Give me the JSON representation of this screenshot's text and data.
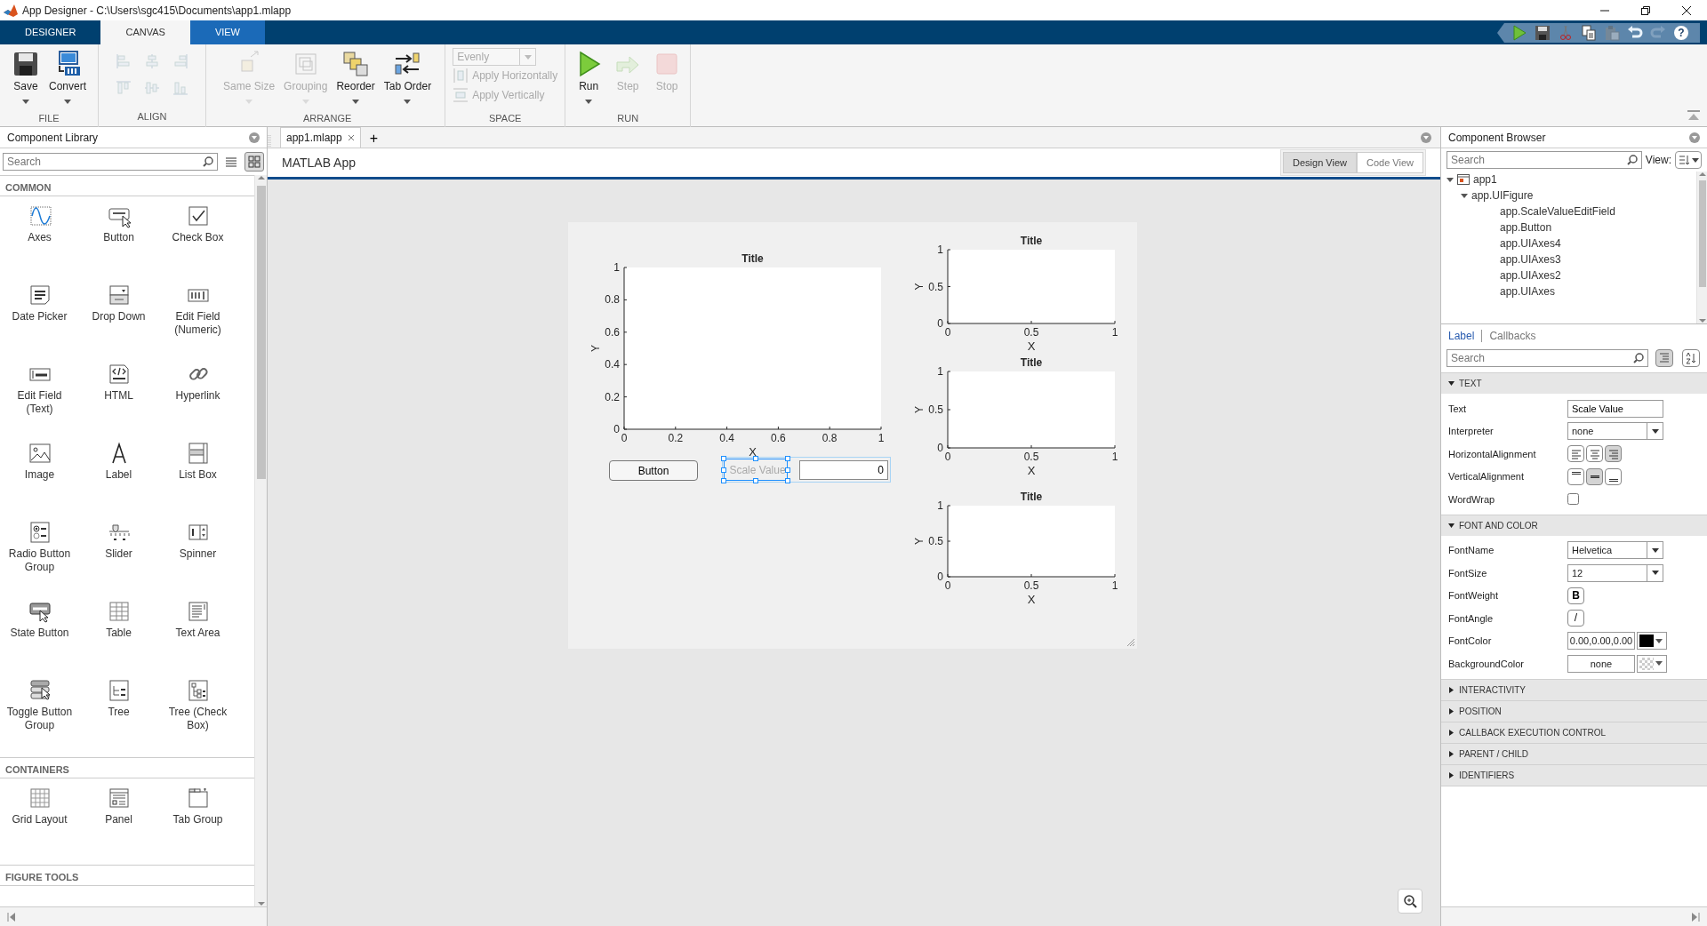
{
  "window": {
    "title": "App Designer - C:\\Users\\sgc415\\Documents\\app1.mlapp"
  },
  "ribbon_tabs": [
    {
      "label": "DESIGNER",
      "kind": "standard",
      "selected": false
    },
    {
      "label": "CANVAS",
      "kind": "standard",
      "selected": true
    },
    {
      "label": "VIEW",
      "kind": "contextual",
      "selected": false
    }
  ],
  "quick_access": [
    {
      "kind": "run",
      "disabled": false
    },
    {
      "kind": "save",
      "disabled": false
    },
    {
      "kind": "cut",
      "disabled": false
    },
    {
      "kind": "copy",
      "disabled": false
    },
    {
      "kind": "paste",
      "disabled": true
    },
    {
      "kind": "undo",
      "disabled": false
    },
    {
      "kind": "redo",
      "disabled": true
    },
    {
      "kind": "help",
      "glyph": "?",
      "disabled": false
    }
  ],
  "ribbon_sections": [
    {
      "title": "FILE",
      "tools": [
        {
          "kind": "save",
          "label": "Save",
          "dropdown": true,
          "disabled": false
        },
        {
          "kind": "convert",
          "label": "Convert",
          "dropdown": true,
          "disabled": false
        }
      ]
    },
    {
      "title": "ALIGN",
      "tools": [
        {
          "kind": "align-left",
          "disabled": true
        },
        {
          "kind": "align-center",
          "disabled": true
        },
        {
          "kind": "align-right",
          "disabled": true
        },
        {
          "kind": "align-top",
          "disabled": true
        },
        {
          "kind": "align-middle",
          "disabled": true
        },
        {
          "kind": "align-bottom",
          "disabled": true
        }
      ]
    },
    {
      "title": "ARRANGE",
      "tools": [
        {
          "kind": "same-size",
          "label": "Same Size",
          "dropdown": true,
          "disabled": true
        },
        {
          "kind": "grouping",
          "label": "Grouping",
          "dropdown": true,
          "disabled": true
        },
        {
          "kind": "reorder",
          "label": "Reorder",
          "dropdown": true,
          "disabled": false
        },
        {
          "kind": "tab-order",
          "label": "Tab Order",
          "dropdown": true,
          "disabled": false
        }
      ]
    },
    {
      "title": "SPACE",
      "tools": [
        {
          "kind": "select",
          "value": "Evenly",
          "disabled": true
        },
        {
          "kind": "space-h",
          "label": "Apply Horizontally",
          "disabled": true
        },
        {
          "kind": "space-v",
          "label": "Apply Vertically",
          "disabled": true
        }
      ]
    },
    {
      "title": "RUN",
      "tools": [
        {
          "kind": "run",
          "label": "Run",
          "dropdown": true,
          "disabled": false
        },
        {
          "kind": "step",
          "label": "Step",
          "disabled": true
        },
        {
          "kind": "stop",
          "label": "Stop",
          "disabled": true
        }
      ]
    }
  ],
  "library": {
    "title": "Component Library",
    "search": {
      "placeholder": "Search"
    },
    "view_modes": [
      {
        "kind": "list",
        "selected": false
      },
      {
        "kind": "grid",
        "selected": true
      }
    ],
    "sections": [
      {
        "title": "COMMON",
        "items": [
          {
            "kind": "axes",
            "label": "Axes"
          },
          {
            "kind": "button",
            "label": "Button"
          },
          {
            "kind": "checkbox",
            "label": "Check Box"
          },
          {
            "kind": "date",
            "label": "Date Picker"
          },
          {
            "kind": "dropdown",
            "label": "Drop Down"
          },
          {
            "kind": "numeric",
            "label": "Edit Field (Numeric)"
          },
          {
            "kind": "text",
            "label": "Edit Field (Text)"
          },
          {
            "kind": "html",
            "label": "HTML"
          },
          {
            "kind": "link",
            "label": "Hyperlink"
          },
          {
            "kind": "image",
            "label": "Image"
          },
          {
            "kind": "label",
            "label": "Label"
          },
          {
            "kind": "listbox",
            "label": "List Box"
          },
          {
            "kind": "radio",
            "label": "Radio Button Group"
          },
          {
            "kind": "slider",
            "label": "Slider"
          },
          {
            "kind": "spinner",
            "label": "Spinner"
          },
          {
            "kind": "state",
            "label": "State Button"
          },
          {
            "kind": "table",
            "label": "Table"
          },
          {
            "kind": "textarea",
            "label": "Text Area"
          },
          {
            "kind": "toggle",
            "label": "Toggle Button Group"
          },
          {
            "kind": "tree",
            "label": "Tree"
          },
          {
            "kind": "checktree",
            "label": "Tree (Check Box)"
          }
        ]
      },
      {
        "title": "CONTAINERS",
        "items": [
          {
            "kind": "grid",
            "label": "Grid Layout"
          },
          {
            "kind": "panel",
            "label": "Panel"
          },
          {
            "kind": "tabs",
            "label": "Tab Group"
          }
        ]
      },
      {
        "title": "FIGURE TOOLS"
      }
    ]
  },
  "documents": [
    {
      "label": "app1.mlapp",
      "selected": true
    }
  ],
  "new_tab": "+",
  "app_header": {
    "title": "MATLAB App",
    "views": [
      {
        "label": "Design View",
        "selected": true
      },
      {
        "label": "Code View",
        "selected": false
      }
    ]
  },
  "canvas": {
    "components": [
      {
        "kind": "axes",
        "chart_data": {
          "type": "line",
          "title": "Title",
          "xlabel": "X",
          "ylabel": "Y",
          "xlim": [
            0,
            1
          ],
          "ylim": [
            0,
            1
          ],
          "xticks": [
            {
              "value": 0,
              "label": "0"
            },
            {
              "value": 0.2,
              "label": "0.2"
            },
            {
              "value": 0.4,
              "label": "0.4"
            },
            {
              "value": 0.6,
              "label": "0.6"
            },
            {
              "value": 0.8,
              "label": "0.8"
            },
            {
              "value": 1,
              "label": "1"
            }
          ],
          "yticks": [
            {
              "value": 0,
              "label": "0"
            },
            {
              "value": 0.2,
              "label": "0.2"
            },
            {
              "value": 0.4,
              "label": "0.4"
            },
            {
              "value": 0.6,
              "label": "0.6"
            },
            {
              "value": 0.8,
              "label": "0.8"
            },
            {
              "value": 1,
              "label": "1"
            }
          ]
        }
      },
      {
        "kind": "axes",
        "chart_data": {
          "type": "line",
          "title": "Title",
          "xlabel": "X",
          "ylabel": "Y",
          "xlim": [
            0,
            1
          ],
          "ylim": [
            0,
            1
          ],
          "xticks": [
            {
              "value": 0,
              "label": "0"
            },
            {
              "value": 0.5,
              "label": "0.5"
            },
            {
              "value": 1,
              "label": "1"
            }
          ],
          "yticks": [
            {
              "value": 0,
              "label": "0"
            },
            {
              "value": 0.5,
              "label": "0.5"
            },
            {
              "value": 1,
              "label": "1"
            }
          ]
        }
      },
      {
        "kind": "axes",
        "chart_data": {
          "type": "line",
          "title": "Title",
          "xlabel": "X",
          "ylabel": "Y",
          "xlim": [
            0,
            1
          ],
          "ylim": [
            0,
            1
          ],
          "xticks": [
            {
              "value": 0,
              "label": "0"
            },
            {
              "value": 0.5,
              "label": "0.5"
            },
            {
              "value": 1,
              "label": "1"
            }
          ],
          "yticks": [
            {
              "value": 0,
              "label": "0"
            },
            {
              "value": 0.5,
              "label": "0.5"
            },
            {
              "value": 1,
              "label": "1"
            }
          ]
        }
      },
      {
        "kind": "axes",
        "chart_data": {
          "type": "line",
          "title": "Title",
          "xlabel": "X",
          "ylabel": "Y",
          "xlim": [
            0,
            1
          ],
          "ylim": [
            0,
            1
          ],
          "xticks": [
            {
              "value": 0,
              "label": "0"
            },
            {
              "value": 0.5,
              "label": "0.5"
            },
            {
              "value": 1,
              "label": "1"
            }
          ],
          "yticks": [
            {
              "value": 0,
              "label": "0"
            },
            {
              "value": 0.5,
              "label": "0.5"
            },
            {
              "value": 1,
              "label": "1"
            }
          ]
        }
      },
      {
        "kind": "button",
        "text": "Button"
      },
      {
        "kind": "label",
        "text": "Scale Value",
        "selected": true
      },
      {
        "kind": "edit-field",
        "value": "0"
      }
    ]
  },
  "browser": {
    "title": "Component Browser",
    "search": {
      "placeholder": "Search"
    },
    "view_label": "View:",
    "tree": [
      {
        "label": "app1",
        "kind": "app",
        "expanded": true,
        "children": [
          {
            "label": "app.UIFigure",
            "expanded": true,
            "children": [
              {
                "label": "app.ScaleValueEditField"
              },
              {
                "label": "app.Button"
              },
              {
                "label": "app.UIAxes4"
              },
              {
                "label": "app.UIAxes3"
              },
              {
                "label": "app.UIAxes2"
              },
              {
                "label": "app.UIAxes"
              }
            ]
          }
        ]
      }
    ]
  },
  "inspector": {
    "tabs": [
      {
        "label": "Label",
        "selected": true
      },
      {
        "label": "Callbacks",
        "selected": false
      }
    ],
    "search": {
      "placeholder": "Search"
    },
    "sort_modes": [
      {
        "kind": "grouped",
        "selected": true
      },
      {
        "kind": "alphabetical",
        "selected": false
      }
    ],
    "groups": [
      {
        "title": "TEXT",
        "expanded": true,
        "properties": [
          {
            "name": "Text",
            "kind": "text",
            "value": "Scale Value"
          },
          {
            "name": "Interpreter",
            "kind": "dropdown",
            "value": "none"
          },
          {
            "name": "HorizontalAlignment",
            "kind": "alignment",
            "options": [
              {
                "kind": "left",
                "selected": false
              },
              {
                "kind": "center",
                "selected": false
              },
              {
                "kind": "right",
                "selected": true
              }
            ]
          },
          {
            "name": "VerticalAlignment",
            "kind": "alignment",
            "options": [
              {
                "kind": "top",
                "selected": false
              },
              {
                "kind": "middle",
                "selected": true
              },
              {
                "kind": "bottom",
                "selected": false
              }
            ]
          },
          {
            "name": "WordWrap",
            "kind": "checkbox",
            "checked": false
          }
        ]
      },
      {
        "title": "FONT AND COLOR",
        "expanded": true,
        "properties": [
          {
            "name": "FontName",
            "kind": "dropdown",
            "value": "Helvetica"
          },
          {
            "name": "FontSize",
            "kind": "dropdown",
            "value": "12"
          },
          {
            "name": "FontWeight",
            "kind": "toggle",
            "glyph": "B",
            "selected": false
          },
          {
            "name": "FontAngle",
            "kind": "toggle",
            "glyph": "/",
            "selected": false
          },
          {
            "name": "FontColor",
            "kind": "color",
            "value": "0.00,0.00,0.00",
            "color": "#000000"
          },
          {
            "name": "BackgroundColor",
            "kind": "color",
            "value": "none"
          }
        ]
      },
      {
        "title": "INTERACTIVITY",
        "expanded": false
      },
      {
        "title": "POSITION",
        "expanded": false
      },
      {
        "title": "CALLBACK EXECUTION CONTROL",
        "expanded": false
      },
      {
        "title": "PARENT / CHILD",
        "expanded": false
      },
      {
        "title": "IDENTIFIERS",
        "expanded": false
      }
    ]
  }
}
